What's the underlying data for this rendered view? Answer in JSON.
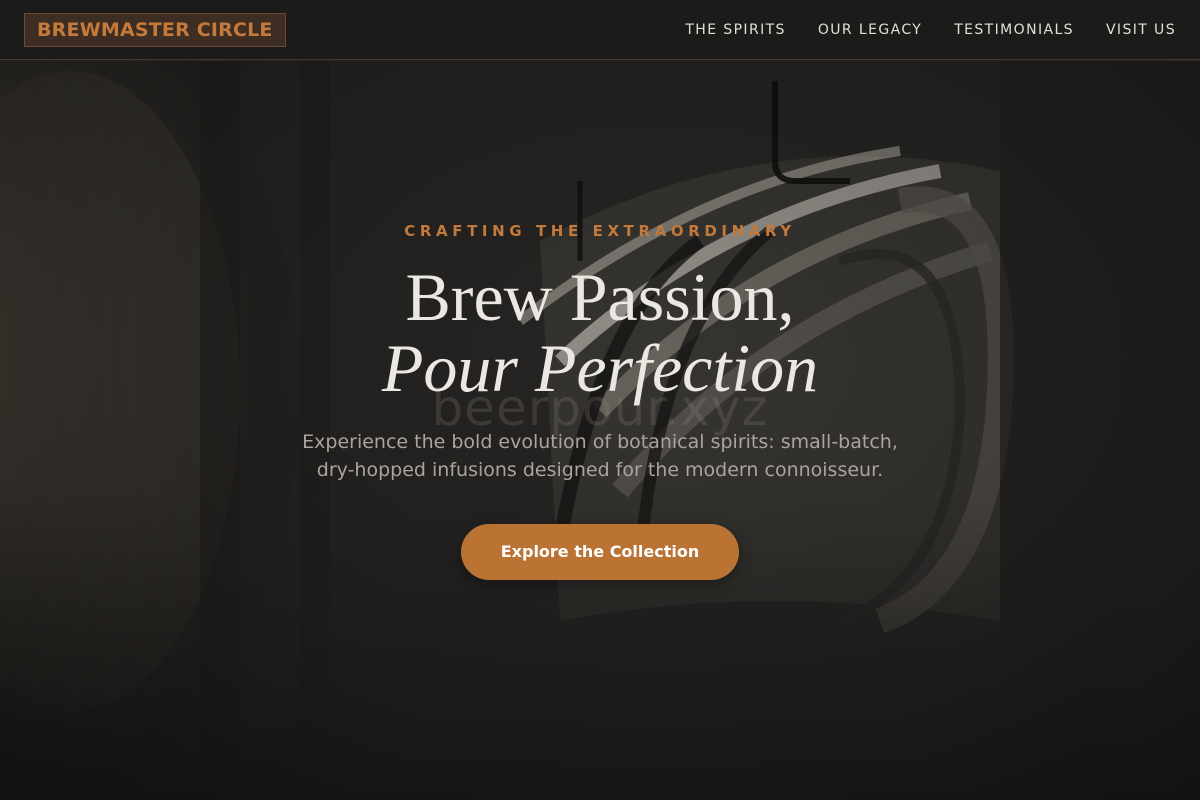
{
  "header": {
    "logo_text": "BREWMASTER CIRCLE",
    "nav": [
      {
        "label": "THE SPIRITS"
      },
      {
        "label": "OUR LEGACY"
      },
      {
        "label": "TESTIMONIALS"
      },
      {
        "label": "VISIT US"
      }
    ]
  },
  "hero": {
    "eyebrow": "CRAFTING THE EXTRAORDINARY",
    "title_line1": "Brew Passion,",
    "title_line2": "Pour Perfection",
    "watermark": "beerpour.xyz",
    "subtitle_line1": "Experience the bold evolution of botanical spirits: small-batch,",
    "subtitle_line2": "dry-hopped infusions designed for the modern connoisseur.",
    "cta_label": "Explore the Collection",
    "background_image": "wooden-barrels-photo"
  },
  "colors": {
    "accent": "#ba7333",
    "eyebrow": "#c27a3c",
    "background": "#222120",
    "header_bg": "#1b1b1a",
    "title_text": "#ebe7e2",
    "subtitle_text": "#aaa49d"
  }
}
